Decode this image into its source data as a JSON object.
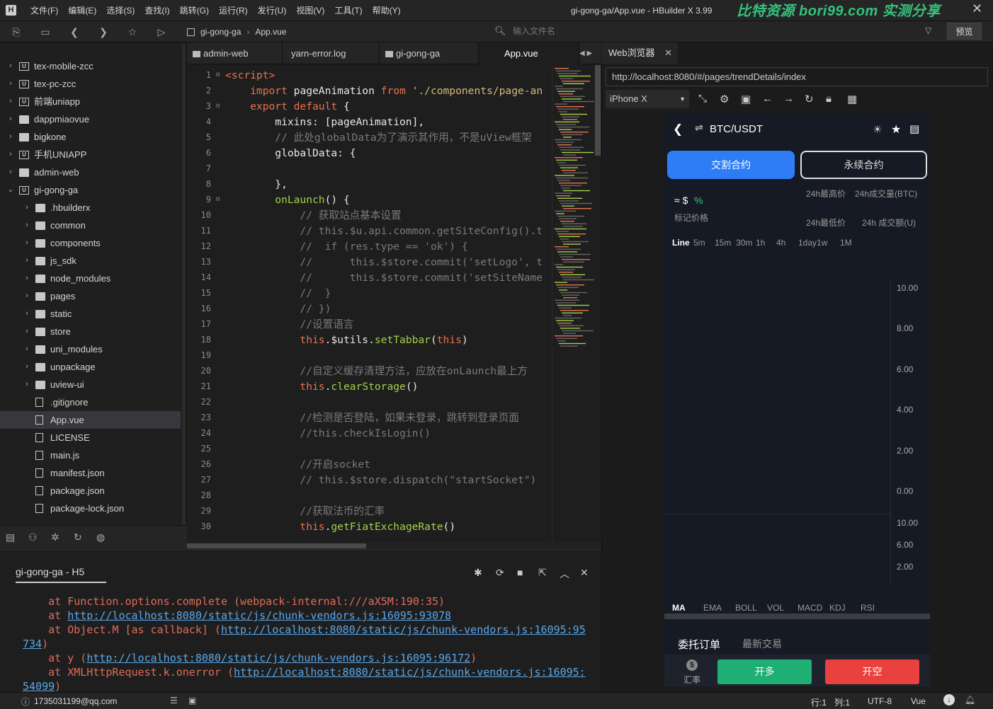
{
  "menu": [
    "文件(F)",
    "编辑(E)",
    "选择(S)",
    "查找(I)",
    "跳转(G)",
    "运行(R)",
    "发行(U)",
    "视图(V)",
    "工具(T)",
    "帮助(Y)"
  ],
  "window_title": "gi-gong-ga/App.vue - HBuilder X 3.99",
  "watermark": "比特资源 bori99.com 实测分享",
  "breadcrumb": {
    "project": "gi-gong-ga",
    "file": "App.vue"
  },
  "file_search_placeholder": "输入文件名",
  "preview_label": "预览",
  "tree": [
    {
      "label": "tex-mobile-zcc",
      "type": "proj",
      "depth": 0,
      "expanded": false
    },
    {
      "label": "tex-pc-zcc",
      "type": "proj",
      "depth": 0,
      "expanded": false
    },
    {
      "label": "前端uniapp",
      "type": "proj",
      "depth": 0,
      "expanded": false
    },
    {
      "label": "dappmiaovue",
      "type": "folder",
      "depth": 0,
      "expanded": false
    },
    {
      "label": "bigkone",
      "type": "folder",
      "depth": 0,
      "expanded": false
    },
    {
      "label": "手机UNIAPP",
      "type": "proj",
      "depth": 0,
      "expanded": false
    },
    {
      "label": "admin-web",
      "type": "folder",
      "depth": 0,
      "expanded": false
    },
    {
      "label": "gi-gong-ga",
      "type": "proj",
      "depth": 0,
      "expanded": true
    },
    {
      "label": ".hbuilderx",
      "type": "folder",
      "depth": 1,
      "expanded": false
    },
    {
      "label": "common",
      "type": "folder",
      "depth": 1,
      "expanded": false
    },
    {
      "label": "components",
      "type": "folder",
      "depth": 1,
      "expanded": false
    },
    {
      "label": "js_sdk",
      "type": "folder",
      "depth": 1,
      "expanded": false
    },
    {
      "label": "node_modules",
      "type": "folder",
      "depth": 1,
      "expanded": false
    },
    {
      "label": "pages",
      "type": "folder",
      "depth": 1,
      "expanded": false
    },
    {
      "label": "static",
      "type": "folder",
      "depth": 1,
      "expanded": false
    },
    {
      "label": "store",
      "type": "folder",
      "depth": 1,
      "expanded": false
    },
    {
      "label": "uni_modules",
      "type": "folder",
      "depth": 1,
      "expanded": false
    },
    {
      "label": "unpackage",
      "type": "folder",
      "depth": 1,
      "expanded": false
    },
    {
      "label": "uview-ui",
      "type": "folder",
      "depth": 1,
      "expanded": false
    },
    {
      "label": ".gitignore",
      "type": "file",
      "depth": 1
    },
    {
      "label": "App.vue",
      "type": "file",
      "depth": 1,
      "selected": true
    },
    {
      "label": "LICENSE",
      "type": "file",
      "depth": 1
    },
    {
      "label": "main.js",
      "type": "file",
      "depth": 1
    },
    {
      "label": "manifest.json",
      "type": "file",
      "depth": 1
    },
    {
      "label": "package.json",
      "type": "file",
      "depth": 1
    },
    {
      "label": "package-lock.json",
      "type": "file",
      "depth": 1
    }
  ],
  "tabs": [
    {
      "label": "admin-web",
      "folder": true
    },
    {
      "label": "yarn-error.log",
      "folder": false
    },
    {
      "label": "gi-gong-ga",
      "folder": true
    },
    {
      "label": "App.vue",
      "folder": false,
      "active": true
    }
  ],
  "code": [
    [
      [
        "t",
        "<script>"
      ]
    ],
    [
      [
        "k",
        "    import "
      ],
      [
        "v",
        "pageAnimation "
      ],
      [
        "k",
        "from "
      ],
      [
        "s",
        "'./components/page-an"
      ]
    ],
    [
      [
        "k",
        "    export default "
      ],
      [
        "v",
        "{"
      ]
    ],
    [
      [
        "v",
        "        mixins: [pageAnimation],"
      ]
    ],
    [
      [
        "c",
        "        // 此处globalData为了演示其作用，不是uView框架"
      ]
    ],
    [
      [
        "v",
        "        globalData: {"
      ]
    ],
    [
      [
        "v",
        ""
      ]
    ],
    [
      [
        "v",
        "        },"
      ]
    ],
    [
      [
        "f",
        "        onLaunch"
      ],
      [
        "v",
        "() {"
      ]
    ],
    [
      [
        "c",
        "            // 获取站点基本设置"
      ]
    ],
    [
      [
        "c",
        "            // this.$u.api.common.getSiteConfig().t"
      ]
    ],
    [
      [
        "c",
        "            //  if (res.type == 'ok') {"
      ]
    ],
    [
      [
        "c",
        "            //      this.$store.commit('setLogo', t"
      ]
    ],
    [
      [
        "c",
        "            //      this.$store.commit('setSiteName"
      ]
    ],
    [
      [
        "c",
        "            //  }"
      ]
    ],
    [
      [
        "c",
        "            // })"
      ]
    ],
    [
      [
        "c",
        "            //设置语言"
      ]
    ],
    [
      [
        "k",
        "            this"
      ],
      [
        "v",
        ".$utils."
      ],
      [
        "f",
        "setTabbar"
      ],
      [
        "v",
        "("
      ],
      [
        "k",
        "this"
      ],
      [
        "v",
        ")"
      ]
    ],
    [
      [
        "v",
        ""
      ]
    ],
    [
      [
        "c",
        "            //自定义缓存清理方法，应放在onLaunch最上方"
      ]
    ],
    [
      [
        "k",
        "            this"
      ],
      [
        "v",
        "."
      ],
      [
        "f",
        "clearStorage"
      ],
      [
        "v",
        "()"
      ]
    ],
    [
      [
        "v",
        ""
      ]
    ],
    [
      [
        "c",
        "            //检测是否登陆，如果未登录，跳转到登录页面"
      ]
    ],
    [
      [
        "c",
        "            //this.checkIsLogin()"
      ]
    ],
    [
      [
        "v",
        ""
      ]
    ],
    [
      [
        "c",
        "            //开启socket"
      ]
    ],
    [
      [
        "c",
        "            // this.$store.dispatch(\"startSocket\")"
      ]
    ],
    [
      [
        "v",
        ""
      ]
    ],
    [
      [
        "c",
        "            //获取法币的汇率"
      ]
    ],
    [
      [
        "k",
        "            this"
      ],
      [
        "v",
        "."
      ],
      [
        "f",
        "getFiatExchageRate"
      ],
      [
        "v",
        "()"
      ]
    ]
  ],
  "console_tab": "gi-gong-ga - H5",
  "console_lines": [
    {
      "pre": "    at Function.options.complete (webpack-internal:///aX5M:190:35)",
      "link": "",
      "post": ""
    },
    {
      "pre": "    at ",
      "link": "http://localhost:8080/static/js/chunk-vendors.js:16095:93078",
      "post": ""
    },
    {
      "pre": "    at Object.M [as callback] (",
      "link": "http://localhost:8080/static/js/chunk-vendors.js:16095:95",
      "post": ""
    },
    {
      "pre": "",
      "link": "734",
      "post": ")"
    },
    {
      "pre": "    at y (",
      "link": "http://localhost:8080/static/js/chunk-vendors.js:16095:96172",
      "post": ")"
    },
    {
      "pre": "    at XMLHttpRequest.k.onerror (",
      "link": "http://localhost:8080/static/js/chunk-vendors.js:16095:",
      "post": ""
    },
    {
      "pre": "",
      "link": "54099",
      "post": ")"
    }
  ],
  "browser": {
    "tab_label": "Web浏览器",
    "url": "http://localhost:8080/#/pages/trendDetails/index",
    "device": "iPhone X"
  },
  "phone": {
    "pair": "BTC/USDT",
    "contract_tabs": [
      "交割合约",
      "永续合约"
    ],
    "price_symbol": "≈ $",
    "pct": "%",
    "mark_price_label": "标记价格",
    "stats": [
      "24h最高价",
      "24h成交量(BTC)",
      "24h最低价",
      "24h 成交额(U)"
    ],
    "timeframes": [
      "Line",
      "5m",
      "15m",
      "30m",
      "1h",
      "4h",
      "1day",
      "1w",
      "1M"
    ],
    "y_ticks_main": [
      "10.00",
      "8.00",
      "6.00",
      "4.00",
      "2.00",
      "0.00"
    ],
    "y_ticks_sub": [
      "10.00",
      "6.00",
      "2.00"
    ],
    "indicators": [
      "MA",
      "EMA",
      "BOLL",
      "VOL",
      "MACD",
      "KDJ",
      "RSI"
    ],
    "order_tabs": [
      "委托订单",
      "最新交易"
    ],
    "rate_label": "汇率",
    "buy_label": "开多",
    "sell_label": "开空"
  },
  "status": {
    "user": "1735031199@qq.com",
    "row": "行:1",
    "col": "列:1",
    "encoding": "UTF-8",
    "lang": "Vue"
  }
}
